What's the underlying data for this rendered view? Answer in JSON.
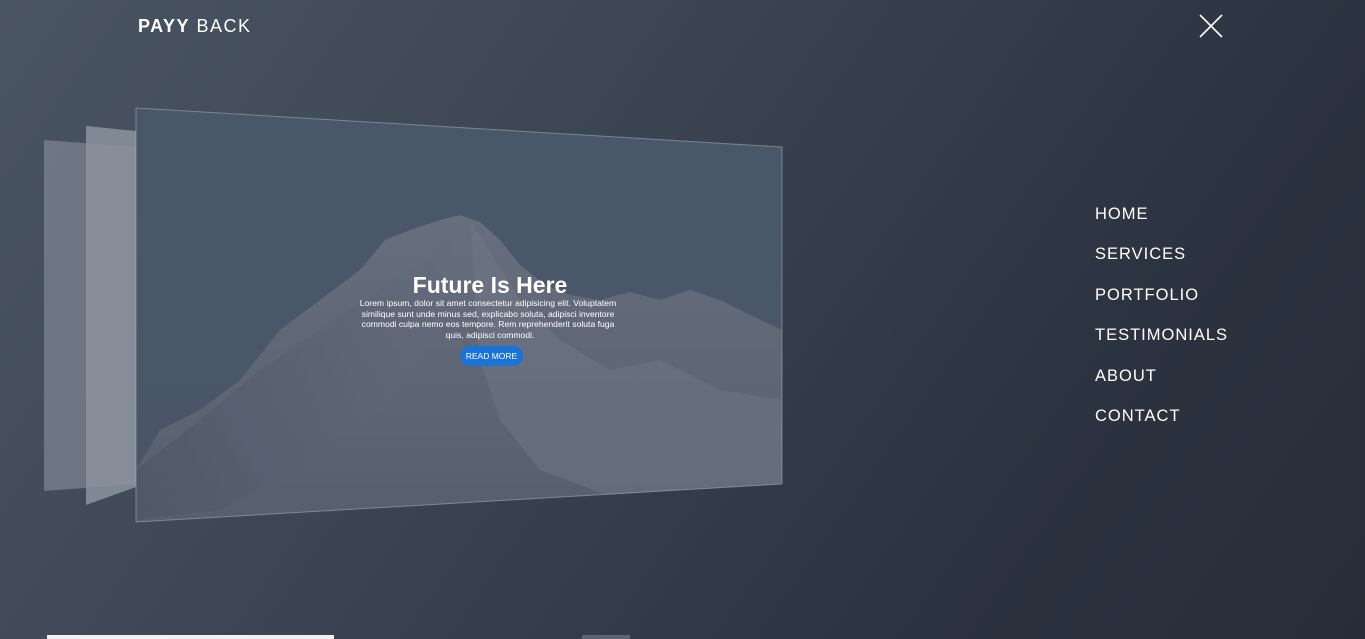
{
  "brand": {
    "bold": "PAYY",
    "light": "BACK"
  },
  "icons": {
    "close": "close-icon"
  },
  "slide": {
    "title": "Future Is Here",
    "text_lines": [
      "Lorem ipsum, dolor sit amet consectetur adipisicing elit. Voluptatem",
      "similique sunt unde minus sed, explicabo soluta, adipisci inventore",
      "commodi culpa nemo eos tempore. Rem reprehenderit soluta fuga",
      "quis, adipisci commodi."
    ],
    "button_label": "READ MORE",
    "button_color": "#1a73d9"
  },
  "nav": {
    "items": [
      "HOME",
      "SERVICES",
      "PORTFOLIO",
      "TESTIMONIALS",
      "ABOUT",
      "CONTACT"
    ]
  }
}
